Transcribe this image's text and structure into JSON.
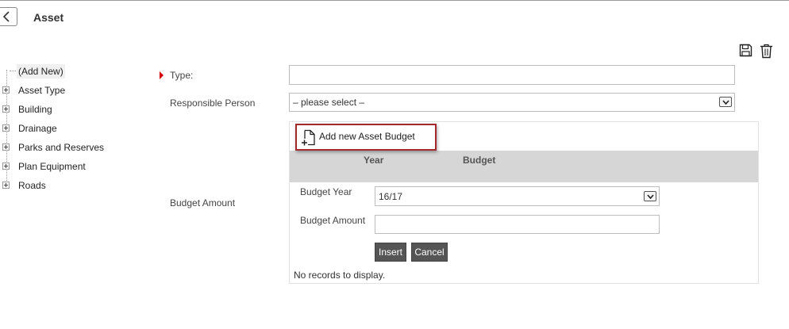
{
  "header": {
    "title": "Asset"
  },
  "tree": {
    "items": [
      {
        "label": "(Add New)",
        "selected": true,
        "expandable": false
      },
      {
        "label": "Asset Type",
        "expandable": true
      },
      {
        "label": "Building",
        "expandable": true
      },
      {
        "label": "Drainage",
        "expandable": true
      },
      {
        "label": "Parks and Reserves",
        "expandable": true
      },
      {
        "label": "Plan Equipment",
        "expandable": true
      },
      {
        "label": "Roads",
        "expandable": true
      }
    ]
  },
  "form": {
    "type_label": "Type:",
    "type_value": "",
    "responsible_label": "Responsible Person",
    "responsible_value": "– please select –",
    "budget_amount_label": "Budget Amount"
  },
  "budget": {
    "add_label": "Add new Asset Budget",
    "columns": [
      "Year",
      "Budget"
    ],
    "budget_year_label": "Budget Year",
    "budget_year_value": "16/17",
    "budget_amount_label": "Budget Amount",
    "budget_amount_value": "",
    "insert_label": "Insert",
    "cancel_label": "Cancel",
    "no_records": "No records to display."
  },
  "icons": {
    "back": "chevron-left-icon",
    "save": "save-icon",
    "delete": "trash-icon",
    "add_budget": "add-document-icon"
  },
  "colors": {
    "required_marker": "#d40000",
    "highlight_border": "#a4282d",
    "button_bg": "#555555",
    "grid_header_bg": "#d6d6d6"
  }
}
